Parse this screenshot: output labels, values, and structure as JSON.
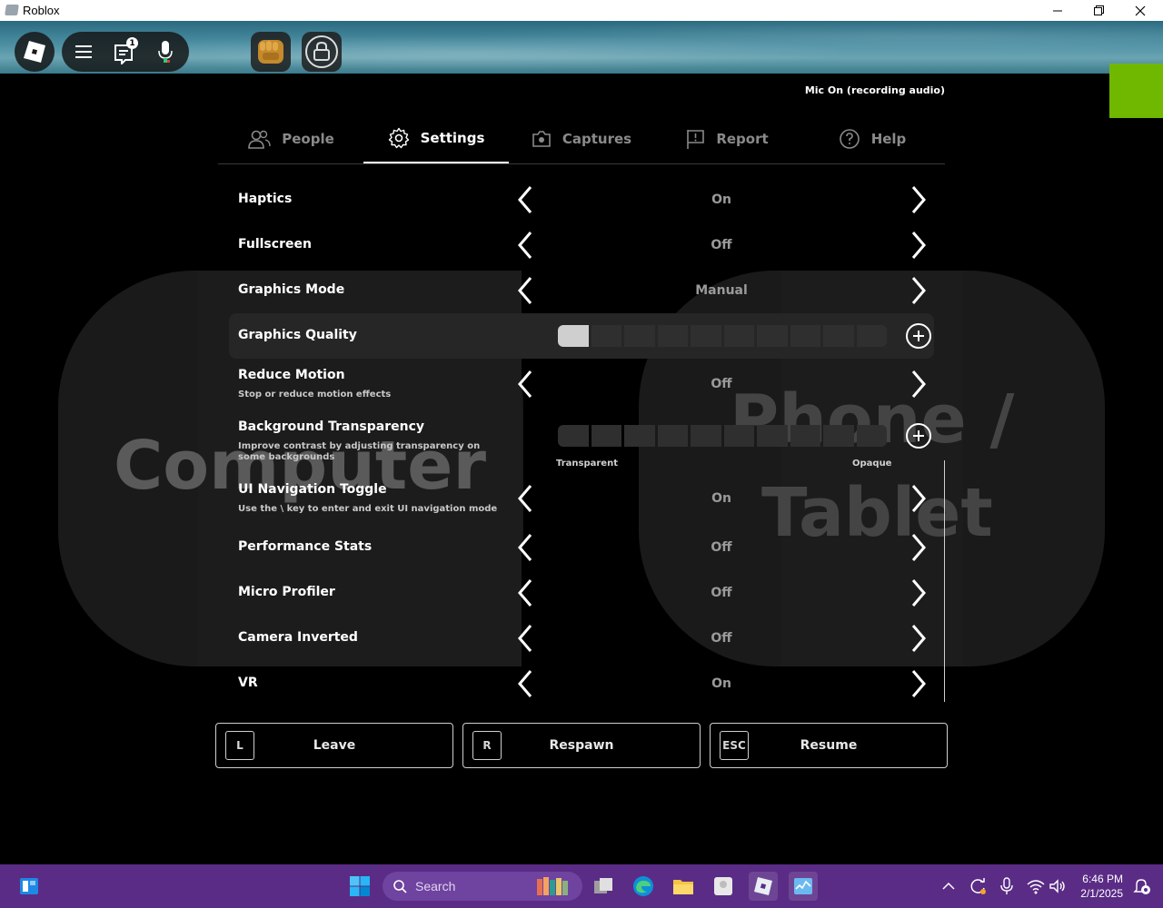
{
  "window": {
    "title": "Roblox"
  },
  "topbar": {
    "chat_badge": "1",
    "mic_status": "Mic On (recording audio)"
  },
  "background_words": {
    "left": "Computer",
    "right_line1": "Phone /",
    "right_line2": "Tablet"
  },
  "tabs": [
    {
      "label": "People",
      "icon": "people-icon",
      "active": false
    },
    {
      "label": "Settings",
      "icon": "gear-icon",
      "active": true
    },
    {
      "label": "Captures",
      "icon": "camera-icon",
      "active": false
    },
    {
      "label": "Report",
      "icon": "flag-icon",
      "active": false
    },
    {
      "label": "Help",
      "icon": "help-icon",
      "active": false
    }
  ],
  "settings": {
    "haptics": {
      "label": "Haptics",
      "value": "On"
    },
    "fullscreen": {
      "label": "Fullscreen",
      "value": "Off"
    },
    "graphics_mode": {
      "label": "Graphics Mode",
      "value": "Manual"
    },
    "graphics_quality": {
      "label": "Graphics Quality",
      "level": 1,
      "max": 10
    },
    "reduce_motion": {
      "label": "Reduce Motion",
      "sub": "Stop or reduce motion effects",
      "value": "Off"
    },
    "background_transparency": {
      "label": "Background Transparency",
      "sub": "Improve contrast by adjusting transparency on some backgrounds",
      "level": 0,
      "max": 10,
      "min_label": "Transparent",
      "max_label": "Opaque"
    },
    "ui_nav_toggle": {
      "label": "UI Navigation Toggle",
      "sub": "Use the \\ key to enter and exit UI navigation mode",
      "value": "On"
    },
    "performance_stats": {
      "label": "Performance Stats",
      "value": "Off"
    },
    "micro_profiler": {
      "label": "Micro Profiler",
      "value": "Off"
    },
    "camera_inverted": {
      "label": "Camera Inverted",
      "value": "Off"
    },
    "vr": {
      "label": "VR",
      "value": "On"
    }
  },
  "actions": {
    "leave": {
      "key": "L",
      "label": "Leave"
    },
    "respawn": {
      "key": "R",
      "label": "Respawn"
    },
    "resume": {
      "key": "ESC",
      "label": "Resume"
    }
  },
  "taskbar": {
    "search_placeholder": "Search",
    "time": "6:46 PM",
    "date": "2/1/2025"
  },
  "colors": {
    "accent_green": "#70b800",
    "taskbar": "#5a2c86",
    "mic_green": "#2ecc71"
  }
}
